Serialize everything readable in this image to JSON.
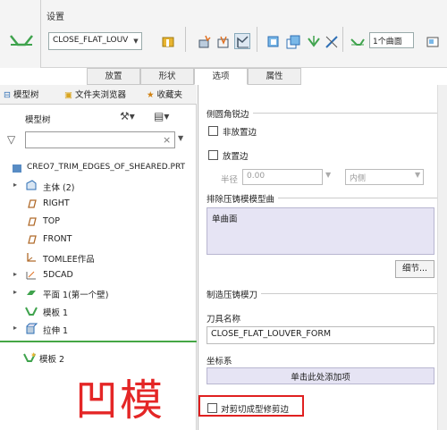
{
  "ribbon": {
    "settings_label": "设置",
    "form_name_display": "CLOSE_FLAT_LOUV",
    "surface_count": "1个曲面",
    "icons": [
      "louver-form-icon",
      "folder-icon",
      "ref-icon",
      "spark-icon",
      "flat-icon",
      "sheet-icon",
      "copy-icon",
      "punch-icon",
      "trim-icon",
      "quilt-icon",
      "extra-icon"
    ]
  },
  "ribbon_tabs": [
    {
      "label": "放置",
      "active": false
    },
    {
      "label": "形状",
      "active": false
    },
    {
      "label": "选项",
      "active": true
    },
    {
      "label": "属性",
      "active": false
    }
  ],
  "tree_panel": {
    "tabs": [
      "模型树",
      "文件夹浏览器",
      "收藏夹"
    ],
    "toolbar_label": "模型树",
    "filter_placeholder": "",
    "clear_symbol": "×",
    "items": [
      {
        "label": "CREO7_TRIM_EDGES_OF_SHEARED.PRT",
        "expander": "",
        "icon": "part-icon",
        "color": "#2e6fb5"
      },
      {
        "label": "主体 (2)",
        "expander": "▸",
        "icon": "body-icon",
        "color": "#2e6fb5"
      },
      {
        "label": "RIGHT",
        "expander": "",
        "icon": "datum-plane-icon",
        "color": "#b06a2a"
      },
      {
        "label": "TOP",
        "expander": "",
        "icon": "datum-plane-icon",
        "color": "#b06a2a"
      },
      {
        "label": "FRONT",
        "expander": "",
        "icon": "datum-plane-icon",
        "color": "#b06a2a"
      },
      {
        "label": "TOMLEE作品",
        "expander": "",
        "icon": "csys-icon",
        "color": "#b06a2a"
      },
      {
        "label": "5DCAD",
        "expander": "▸",
        "icon": "sketch-icon",
        "color": "#666"
      },
      {
        "label": "平面 1(第一个壁)",
        "expander": "▸",
        "icon": "flat-wall-icon",
        "color": "#3fa34d"
      },
      {
        "label": "模板 1",
        "expander": "",
        "icon": "form-icon",
        "color": "#3fa34d"
      },
      {
        "label": "拉伸 1",
        "expander": "▸",
        "icon": "extrude-icon",
        "color": "#2e6fb5"
      },
      {
        "label": "模板 2",
        "expander": "",
        "icon": "form-new-icon",
        "color": "#3fa34d"
      }
    ]
  },
  "options": {
    "side_edge_title": "侧圆角锐边",
    "no_place_edge": "非放置边",
    "place_edge": "放置边",
    "radius_label": "半径",
    "radius_value": "0.00",
    "inner_side_value": "内侧",
    "exclude_title": "排除压铸模模型曲",
    "exclude_item": "单曲面",
    "details_button": "细节...",
    "manufacture_title": "制造压铸模刀",
    "tool_name_label": "刀具名称",
    "tool_name_value": "CLOSE_FLAT_LOUVER_FORM",
    "csys_label": "坐标系",
    "csys_prompt": "单击此处添加项",
    "trim_checkbox_label": "对剪切成型修剪边"
  },
  "annotation": {
    "big_text": "凹模",
    "color": "#e42626"
  }
}
